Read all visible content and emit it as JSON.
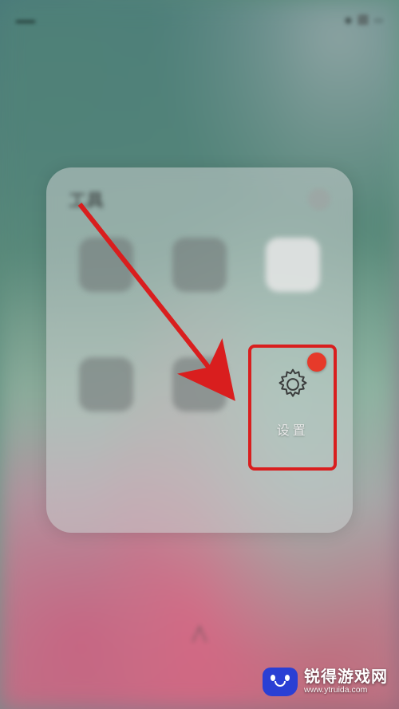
{
  "status": {
    "carrier_area": "",
    "time": "",
    "battery_area": ""
  },
  "folder": {
    "title": "工具",
    "apps": [
      {
        "label": ""
      },
      {
        "label": ""
      },
      {
        "label": ""
      },
      {
        "label": ""
      },
      {
        "label": ""
      },
      {
        "label": "设置",
        "highlighted": true
      }
    ]
  },
  "highlight": {
    "target": "settings-app",
    "arrowColor": "#d91e1e"
  },
  "watermark": {
    "brand": "锐得游戏网",
    "url": "www.ytruida.com"
  }
}
